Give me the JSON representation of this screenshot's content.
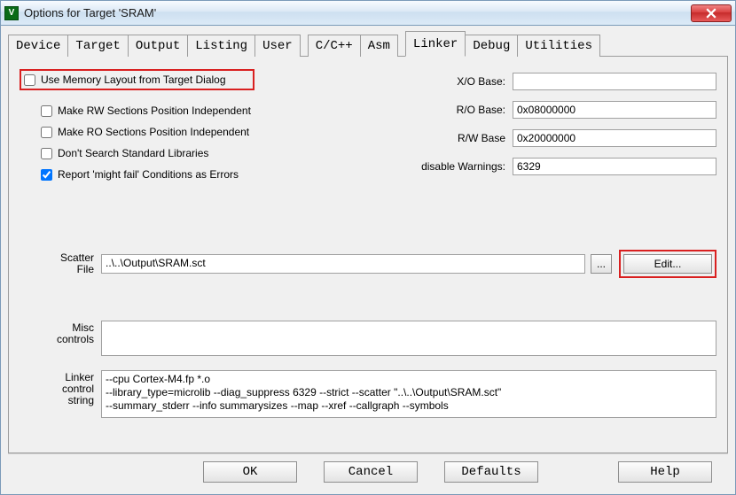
{
  "window": {
    "title": "Options for Target 'SRAM'",
    "icon_letter": "V"
  },
  "tabs": [
    {
      "label": "Device"
    },
    {
      "label": "Target"
    },
    {
      "label": "Output"
    },
    {
      "label": "Listing"
    },
    {
      "label": "User"
    },
    {
      "label": "C/C++"
    },
    {
      "label": "Asm"
    },
    {
      "label": "Linker",
      "active": true
    },
    {
      "label": "Debug"
    },
    {
      "label": "Utilities"
    }
  ],
  "linker": {
    "use_memory_layout_label": "Use Memory Layout from Target Dialog",
    "use_memory_layout_checked": false,
    "make_rw_label": "Make RW Sections Position Independent",
    "make_rw_checked": false,
    "make_ro_label": "Make RO Sections Position Independent",
    "make_ro_checked": false,
    "no_stdlib_label": "Don't Search Standard Libraries",
    "no_stdlib_checked": false,
    "report_might_fail_label": "Report 'might fail' Conditions as Errors",
    "report_might_fail_checked": true,
    "xo_base_label": "X/O Base:",
    "xo_base_value": "",
    "ro_base_label": "R/O Base:",
    "ro_base_value": "0x08000000",
    "rw_base_label": "R/W Base",
    "rw_base_value": "0x20000000",
    "disable_warnings_label": "disable Warnings:",
    "disable_warnings_value": "6329",
    "scatter_label": "Scatter\nFile",
    "scatter_value": "..\\..\\Output\\SRAM.sct",
    "browse_label": "...",
    "edit_label": "Edit...",
    "misc_label": "Misc\ncontrols",
    "misc_value": "",
    "linker_ctrl_label": "Linker\ncontrol\nstring",
    "linker_ctrl_value": "--cpu Cortex-M4.fp *.o\n--library_type=microlib --diag_suppress 6329 --strict --scatter \"..\\..\\Output\\SRAM.sct\"\n--summary_stderr --info summarysizes --map --xref --callgraph --symbols"
  },
  "buttons": {
    "ok": "OK",
    "cancel": "Cancel",
    "defaults": "Defaults",
    "help": "Help"
  }
}
